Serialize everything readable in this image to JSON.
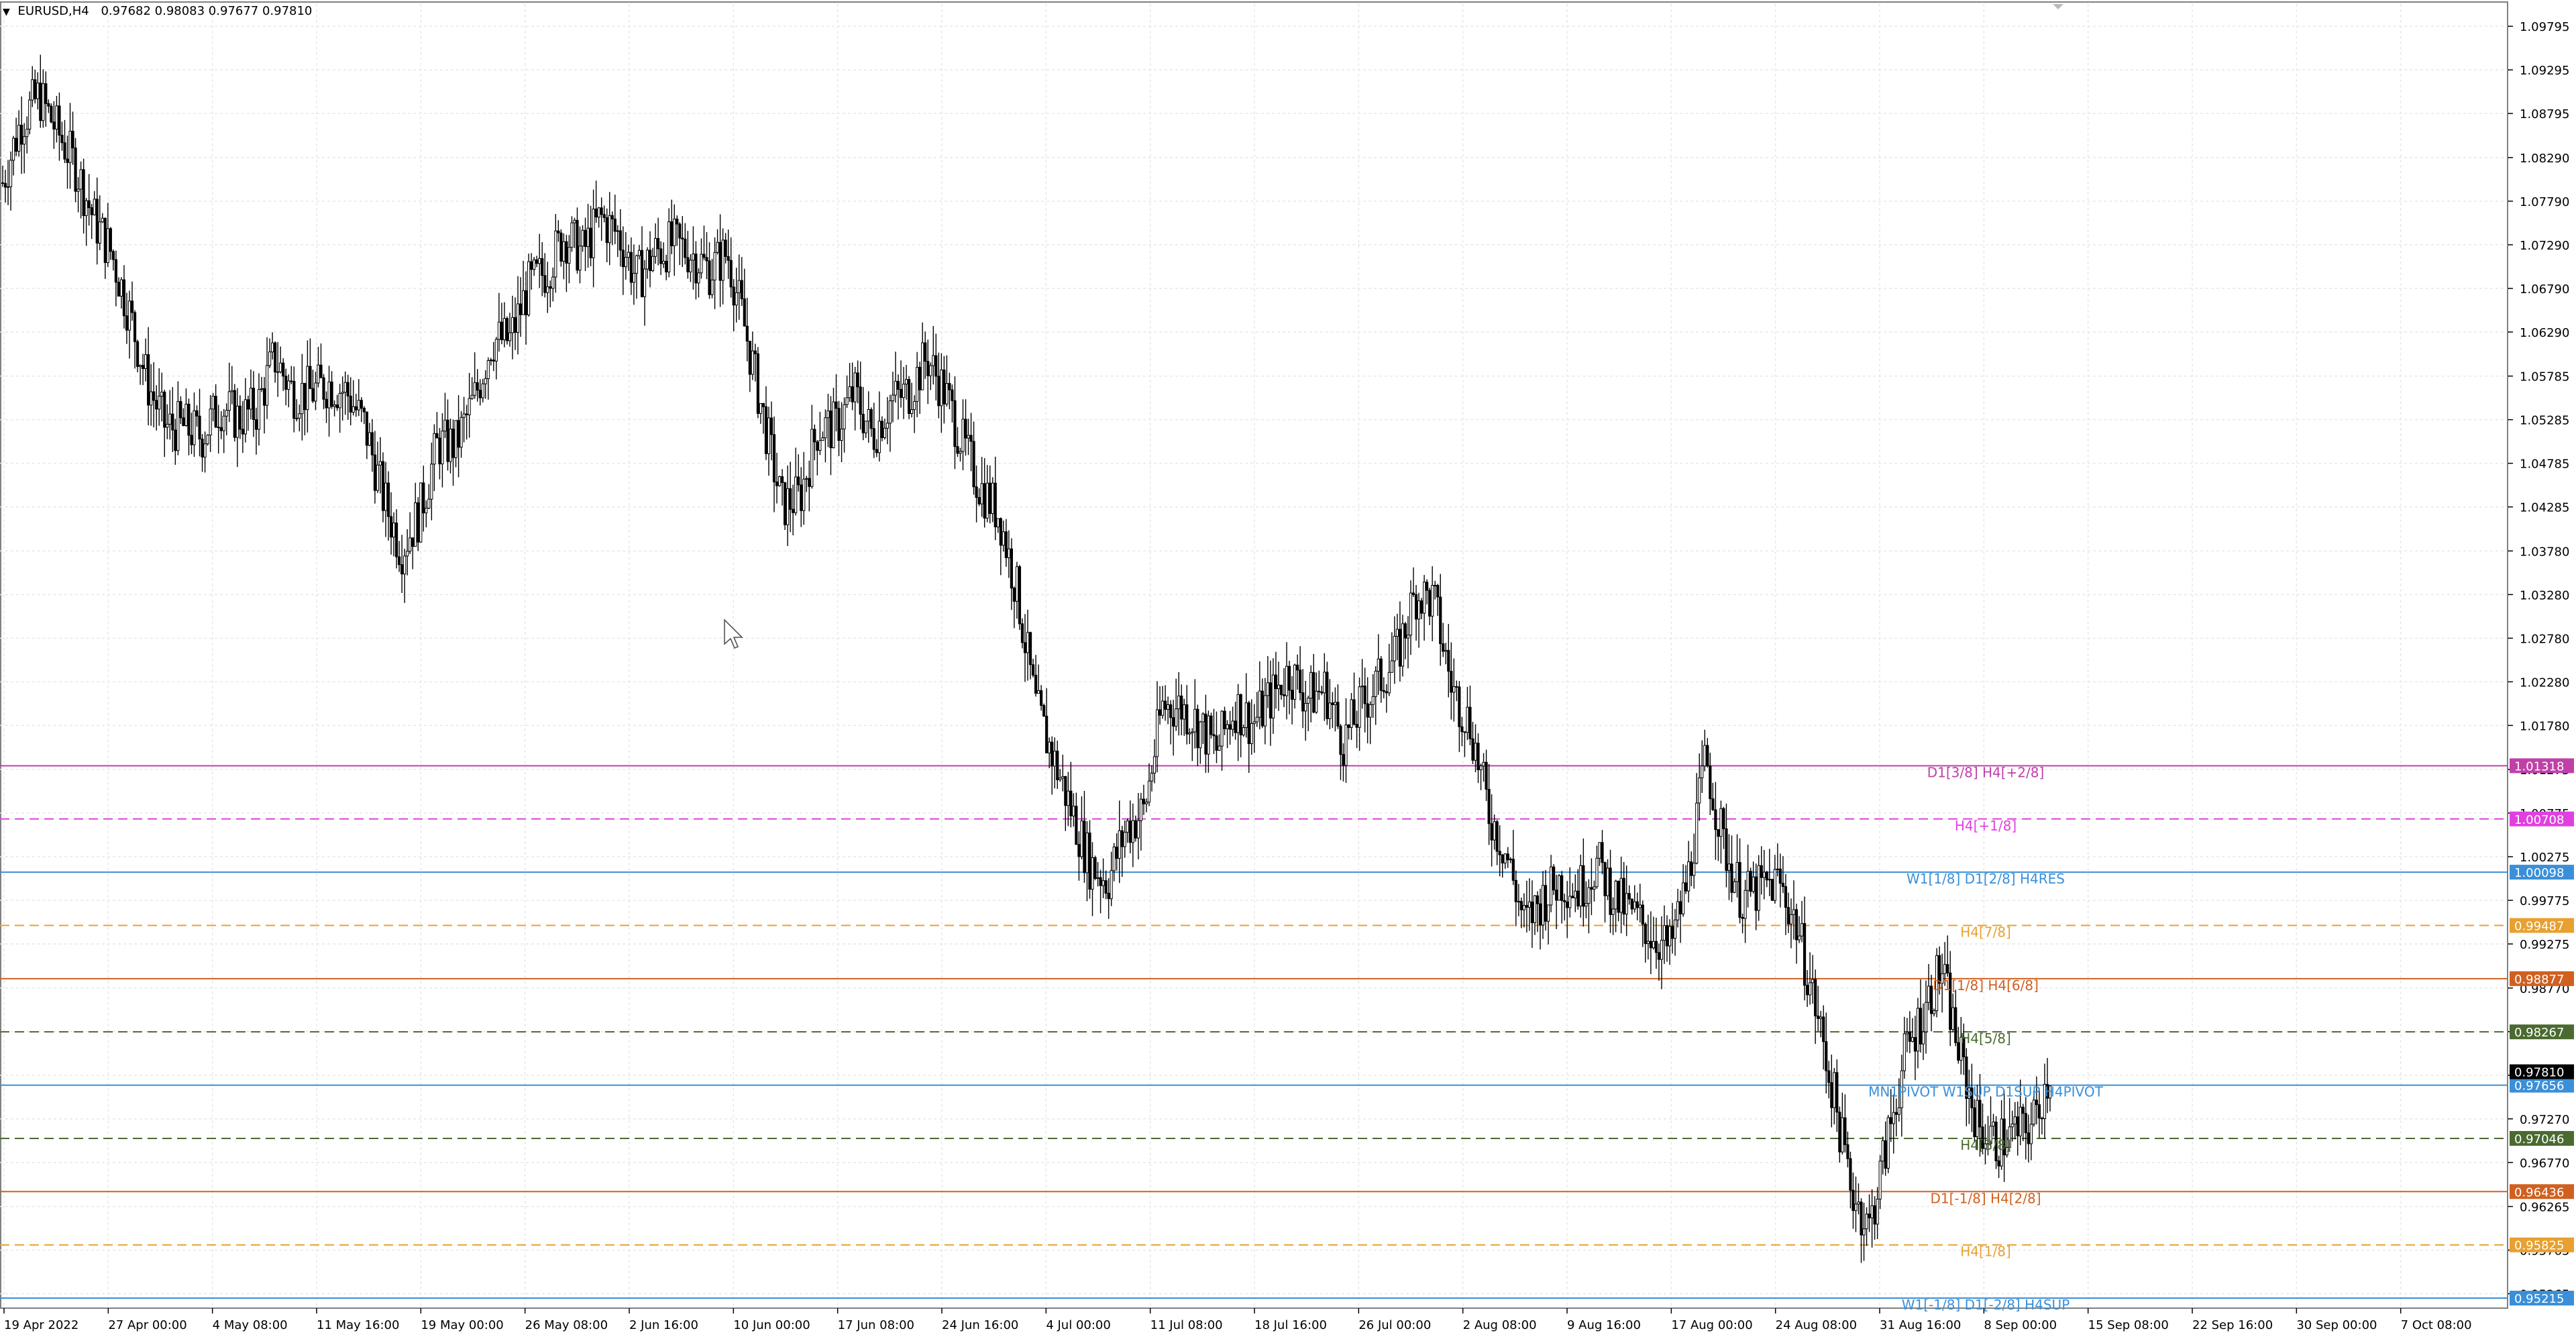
{
  "header": {
    "symbol": "EURUSD,H4",
    "ohlc": "0.97682 0.98083 0.97677 0.97810"
  },
  "chart_data": {
    "type": "candlestick",
    "symbol": "EURUSD",
    "timeframe": "H4",
    "ylim": [
      0.951,
      1.1005
    ],
    "grid": true,
    "price_ticks": [
      "1.09795",
      "1.09295",
      "1.08795",
      "1.08290",
      "1.07790",
      "1.07290",
      "1.06790",
      "1.06290",
      "1.05785",
      "1.05285",
      "1.04785",
      "1.04285",
      "1.03780",
      "1.03280",
      "1.02780",
      "1.02280",
      "1.01780",
      "1.01275",
      "1.00775",
      "1.00275",
      "0.99775",
      "0.99275",
      "0.98770",
      "0.98270",
      "0.97770",
      "0.97270",
      "0.96770",
      "0.96265",
      "0.95765",
      "0.95265"
    ],
    "time_labels": [
      "19 Apr 2022",
      "27 Apr 00:00",
      "4 May 08:00",
      "11 May 16:00",
      "19 May 00:00",
      "26 May 08:00",
      "2 Jun 16:00",
      "10 Jun 00:00",
      "17 Jun 08:00",
      "24 Jun 16:00",
      "4 Jul 00:00",
      "11 Jul 08:00",
      "18 Jul 16:00",
      "26 Jul 00:00",
      "2 Aug 08:00",
      "9 Aug 16:00",
      "17 Aug 00:00",
      "24 Aug 08:00",
      "31 Aug 16:00",
      "8 Sep 00:00",
      "15 Sep 08:00",
      "22 Sep 16:00",
      "30 Sep 00:00",
      "7 Oct 08:00"
    ],
    "current_price": "0.97810",
    "close_path": [
      1.08,
      1.087,
      1.09,
      1.086,
      1.082,
      1.076,
      1.072,
      1.065,
      1.057,
      1.052,
      1.052,
      1.051,
      1.0545,
      1.053,
      1.054,
      1.06,
      1.056,
      1.056,
      1.057,
      1.056,
      1.052,
      1.044,
      1.038,
      1.042,
      1.05,
      1.05,
      1.055,
      1.062,
      1.062,
      1.068,
      1.07,
      1.074,
      1.072,
      1.076,
      1.074,
      1.069,
      1.072,
      1.073,
      1.072,
      1.07,
      1.072,
      1.063,
      1.053,
      1.043,
      1.044,
      1.052,
      1.052,
      1.056,
      1.051,
      1.055,
      1.056,
      1.06,
      1.056,
      1.05,
      1.045,
      1.042,
      1.033,
      1.02,
      1.014,
      1.008,
      1.002,
      1.0,
      1.006,
      1.008,
      1.02,
      1.02,
      1.018,
      1.015,
      1.02,
      1.018,
      1.021,
      1.024,
      1.021,
      1.022,
      1.016,
      1.02,
      1.023,
      1.026,
      1.033,
      1.032,
      1.022,
      1.018,
      1.008,
      1.003,
      0.995,
      0.998,
      1.0,
      0.999,
      1.002,
      0.998,
      0.996,
      0.994,
      0.992,
      1.0,
      1.014,
      1.004,
      0.998,
      0.999,
      1.0,
      0.995,
      0.986,
      0.976,
      0.965,
      0.96,
      0.97,
      0.98,
      0.985,
      0.99,
      0.98,
      0.972,
      0.97,
      0.971,
      0.972,
      0.9781
    ],
    "levels": [
      {
        "label": "D1[3/8] H4[+2/8]",
        "price": "1.01318",
        "color": "#c040a8",
        "style": "solid"
      },
      {
        "label": "H4[+1/8]",
        "price": "1.00708",
        "color": "#e040e0",
        "style": "dashed"
      },
      {
        "label": "W1[1/8] D1[2/8] H4RES",
        "price": "1.00098",
        "color": "#3a8fd8",
        "style": "solid"
      },
      {
        "label": "H4[7/8]",
        "price": "0.99487",
        "color": "#e8a030",
        "style": "dashed"
      },
      {
        "label": "D1[1/8] H4[6/8]",
        "price": "0.98877",
        "color": "#d06020",
        "style": "solid"
      },
      {
        "label": "H4[5/8]",
        "price": "0.98267",
        "color": "#4a6a30",
        "style": "dashed"
      },
      {
        "label": "MN1PIVOT W1SUP D1SUP H4PIVOT",
        "price": "0.97656",
        "color": "#3a8fd8",
        "style": "solid"
      },
      {
        "label": "H4[3/8]",
        "price": "0.97046",
        "color": "#4a6a30",
        "style": "dashed"
      },
      {
        "label": "D1[-1/8] H4[2/8]",
        "price": "0.96436",
        "color": "#d06020",
        "style": "solid"
      },
      {
        "label": "H4[1/8]",
        "price": "0.95825",
        "color": "#e8a030",
        "style": "dashed"
      },
      {
        "label": "W1[-1/8] D1[-2/8] H4SUP",
        "price": "0.95215",
        "color": "#3a8fd8",
        "style": "solid"
      }
    ]
  },
  "colors": {
    "background": "#ffffff",
    "grid": "#e8e8e8",
    "candle": "#000000",
    "current_price_bg": "#000000"
  },
  "icons": [
    "dropdown-caret-icon",
    "mouse-pointer-icon"
  ]
}
